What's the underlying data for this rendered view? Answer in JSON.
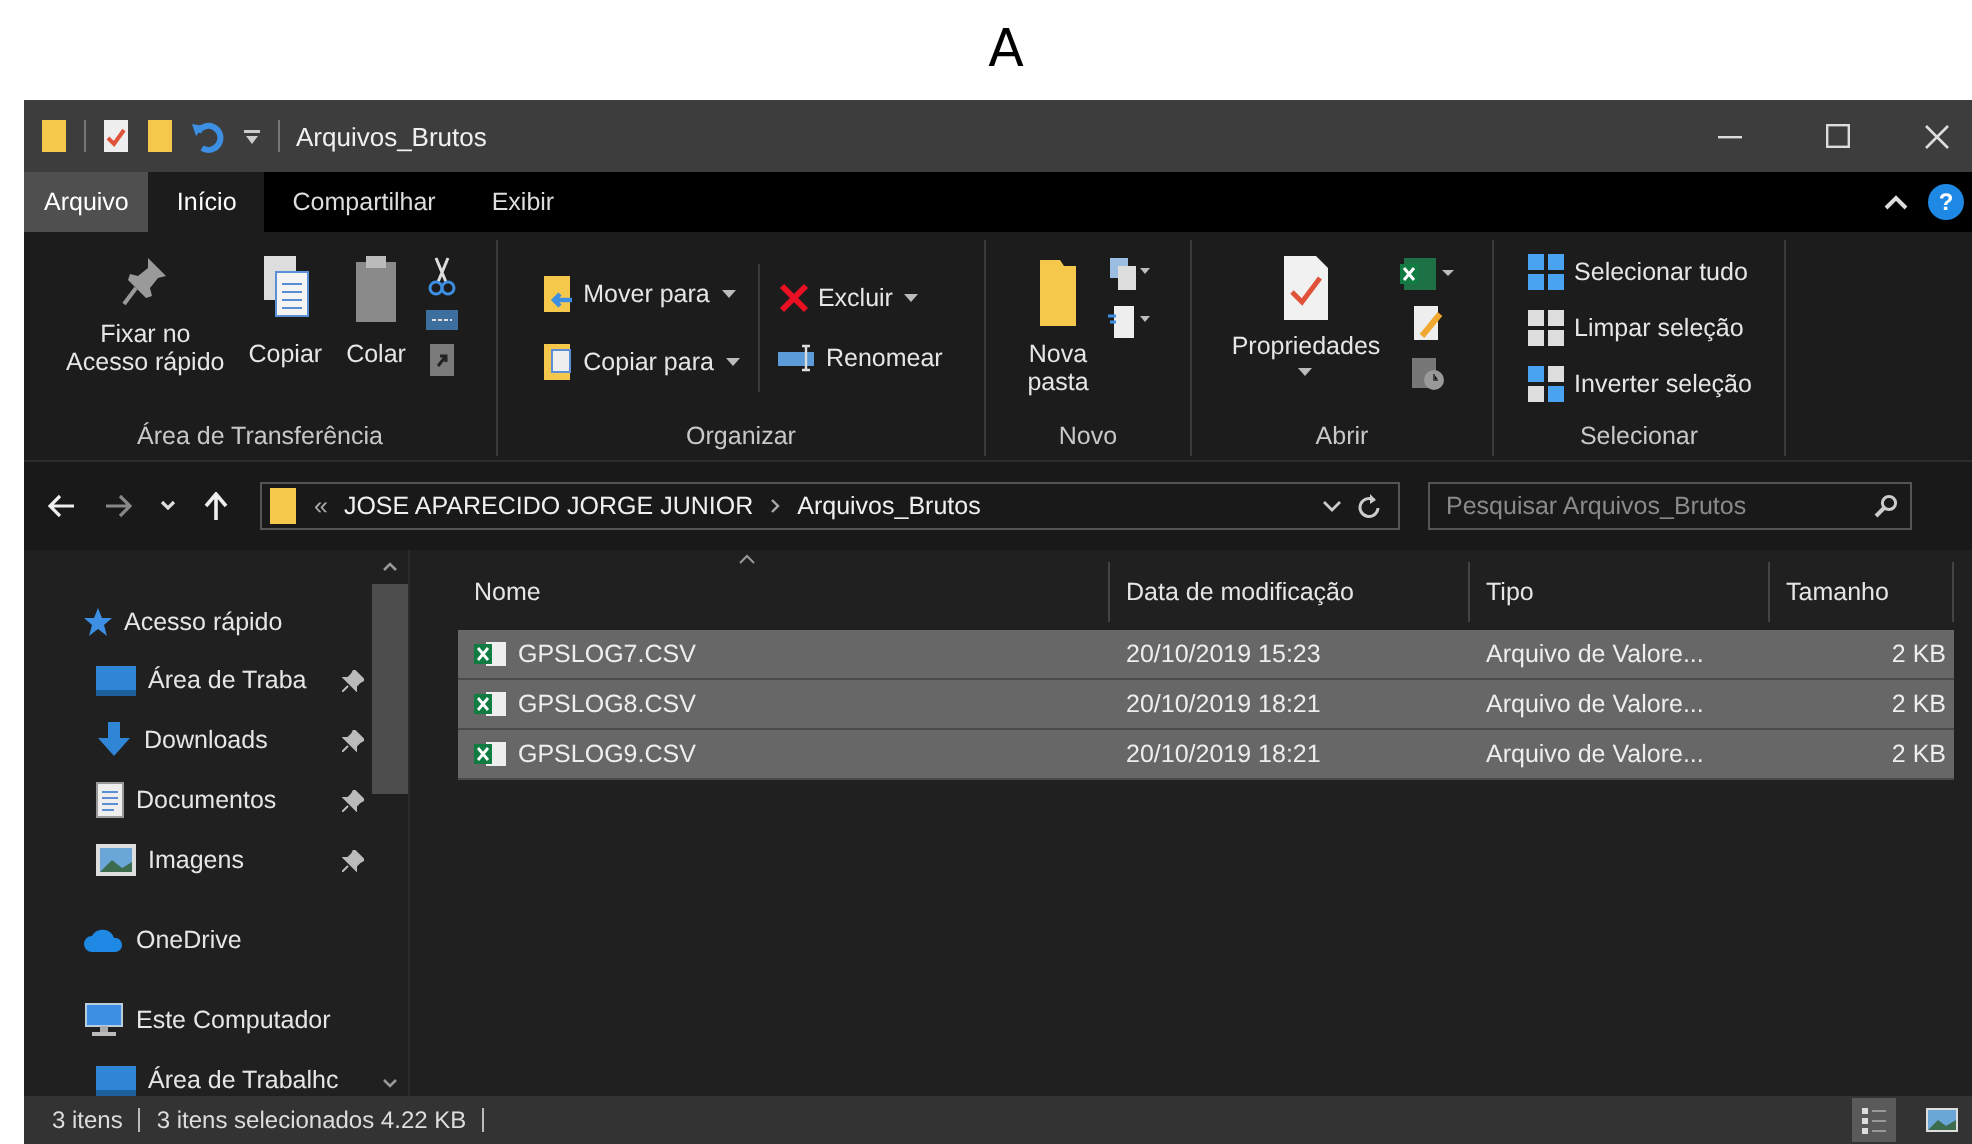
{
  "heading": "A",
  "window": {
    "title": "Arquivos_Brutos"
  },
  "menu_tabs": [
    {
      "label": "Arquivo",
      "kind": "file",
      "selected": false
    },
    {
      "label": "Início",
      "kind": "tab",
      "selected": true
    },
    {
      "label": "Compartilhar",
      "kind": "tab",
      "selected": false
    },
    {
      "label": "Exibir",
      "kind": "tab",
      "selected": false
    }
  ],
  "help": "?",
  "ribbon": {
    "groups": [
      {
        "label": "Área de Transferência",
        "buttons": [
          "Fixar no\nAcesso rápido",
          "Copiar",
          "Colar"
        ]
      },
      {
        "label": "Organizar",
        "buttons": [
          "Mover para",
          "Copiar para",
          "Excluir",
          "Renomear"
        ]
      },
      {
        "label": "Novo",
        "buttons": [
          "Nova\npasta"
        ]
      },
      {
        "label": "Abrir",
        "buttons": [
          "Propriedades"
        ]
      },
      {
        "label": "Selecionar",
        "buttons": [
          "Selecionar tudo",
          "Limpar seleção",
          "Inverter seleção"
        ]
      }
    ]
  },
  "address": {
    "overflow": "«",
    "segments": [
      "JOSE APARECIDO JORGE JUNIOR",
      "Arquivos_Brutos"
    ]
  },
  "search": {
    "placeholder": "Pesquisar Arquivos_Brutos"
  },
  "sidebar": {
    "items": [
      {
        "label": "Acesso rápido",
        "children": [
          {
            "label": "Área de Traba",
            "pinned": true
          },
          {
            "label": "Downloads",
            "pinned": true
          },
          {
            "label": "Documentos",
            "pinned": true
          },
          {
            "label": "Imagens",
            "pinned": true
          }
        ]
      },
      {
        "label": "OneDrive"
      },
      {
        "label": "Este Computador",
        "children": [
          {
            "label": "Área de Trabalhc",
            "pinned": false
          }
        ]
      }
    ]
  },
  "table": {
    "columns": [
      "Nome",
      "Data de modificação",
      "Tipo",
      "Tamanho"
    ],
    "rows": [
      {
        "name": "GPSLOG7.CSV",
        "date": "20/10/2019 15:23",
        "type": "Arquivo de Valore...",
        "size": "2 KB",
        "selected": true
      },
      {
        "name": "GPSLOG8.CSV",
        "date": "20/10/2019 18:21",
        "type": "Arquivo de Valore...",
        "size": "2 KB",
        "selected": true
      },
      {
        "name": "GPSLOG9.CSV",
        "date": "20/10/2019 18:21",
        "type": "Arquivo de Valore...",
        "size": "2 KB",
        "selected": true
      }
    ]
  },
  "status_bar": {
    "count": "3 itens",
    "selection": "3 itens selecionados  4.22 KB",
    "views": [
      {
        "selected": true
      },
      {
        "selected": false
      }
    ]
  }
}
